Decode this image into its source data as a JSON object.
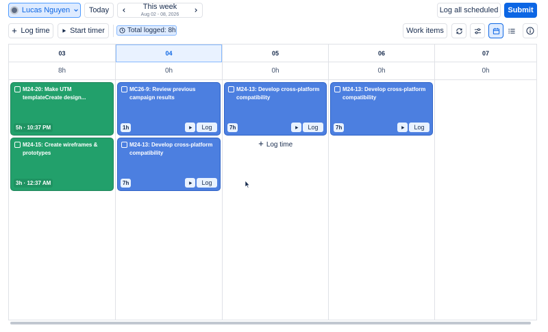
{
  "toolbar": {
    "user_name": "Lucas Nguyen",
    "today_label": "Today",
    "week_title": "This week",
    "week_range": "Aug 02 - 08, 2026",
    "log_all_label": "Log all scheduled",
    "submit_label": "Submit",
    "log_time_label": "Log time",
    "start_timer_label": "Start timer",
    "total_logged": "Total logged: 8h",
    "work_items_label": "Work items"
  },
  "days": [
    {
      "date": "03",
      "total": "8h",
      "today": false
    },
    {
      "date": "04",
      "total": "0h",
      "today": true
    },
    {
      "date": "05",
      "total": "0h",
      "today": false
    },
    {
      "date": "06",
      "total": "0h",
      "today": false
    },
    {
      "date": "07",
      "total": "0h",
      "today": false
    }
  ],
  "cards": [
    {
      "day": 0,
      "slot": 0,
      "color": "green",
      "icon": "subtask-icon",
      "title": "M24-20: Make UTM templateCreate design...",
      "meta": "5h · 10:37 PM",
      "actions": false
    },
    {
      "day": 0,
      "slot": 1,
      "color": "green",
      "icon": "task-icon",
      "title": "M24-15: Create wireframes & prototypes",
      "meta": "3h · 12:37 AM",
      "actions": false
    },
    {
      "day": 1,
      "slot": 0,
      "color": "blue",
      "icon": "task-icon",
      "title": "MC26-9: Review previous campaign results",
      "meta": "1h",
      "actions": true
    },
    {
      "day": 1,
      "slot": 1,
      "color": "blue",
      "icon": "task-icon",
      "title": "M24-13: Develop cross-platform compatibility",
      "meta": "7h",
      "actions": true
    },
    {
      "day": 2,
      "slot": 0,
      "color": "blue",
      "icon": "task-icon",
      "title": "M24-13: Develop cross-platform compatibility",
      "meta": "7h",
      "actions": true
    },
    {
      "day": 3,
      "slot": 0,
      "color": "blue",
      "icon": "task-icon",
      "title": "M24-13: Develop cross-platform compatibility",
      "meta": "7h",
      "actions": true
    }
  ],
  "card_log_label": "Log",
  "add_log_label": "Log time",
  "colors": {
    "accent": "#0c66e4",
    "green_card": "#22a06b",
    "blue_card": "#4c7fe0"
  }
}
